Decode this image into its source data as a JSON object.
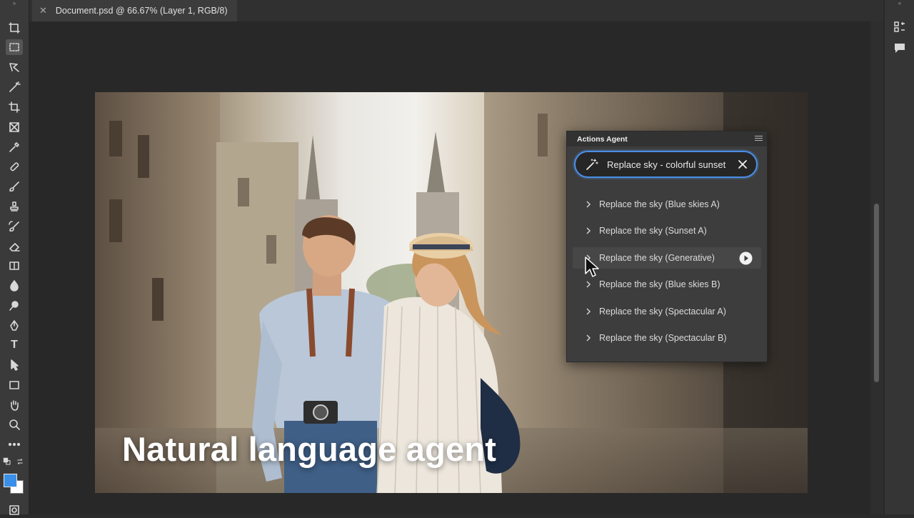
{
  "document_tab": {
    "title": "Document.psd @ 66.67% (Layer 1, RGB/8)",
    "close_glyph": "✕"
  },
  "toolbar": {
    "tools": [
      "artboard-move",
      "rectangular-marquee",
      "object-selection",
      "magic-wand",
      "crop",
      "frame",
      "eyedropper",
      "healing-brush",
      "brush",
      "clone-stamp",
      "history-brush",
      "eraser",
      "gradient",
      "blur",
      "dodge",
      "pen",
      "type",
      "path-selection",
      "rectangle",
      "hand",
      "zoom",
      "more-tools"
    ],
    "type_tool_glyph": "T",
    "foreground_color": "#3a8fe8",
    "background_color": "#ffffff"
  },
  "canvas": {
    "overlay_caption": "Natural language agent"
  },
  "actions_agent": {
    "title": "Actions Agent",
    "prompt": "Replace sky - colorful sunset",
    "actions": [
      {
        "label": "Replace the sky (Blue skies A)"
      },
      {
        "label": "Replace the sky (Sunset A)"
      },
      {
        "label": "Replace the sky (Generative)",
        "hovered": true
      },
      {
        "label": "Replace the sky (Blue skies B)"
      },
      {
        "label": "Replace the sky (Spectacular A)"
      },
      {
        "label": "Replace the sky (Spectacular B)"
      }
    ]
  },
  "colors": {
    "accent": "#4b8fe6",
    "panel_bg": "#3d3d3d",
    "app_bg": "#282828"
  }
}
